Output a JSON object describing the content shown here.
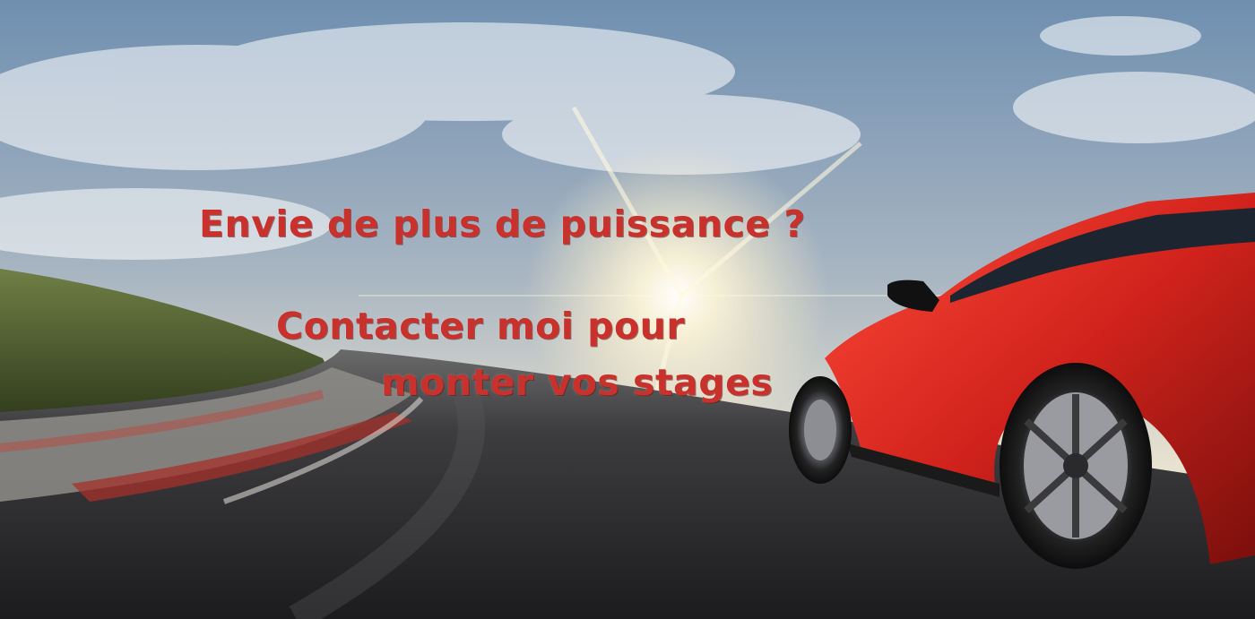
{
  "banner": {
    "line1": "Envie de plus de puissance ?",
    "line2": "Contacter moi pour",
    "line3": "monter vos stages"
  },
  "colors": {
    "text": "#c8312c",
    "car_body": "#d2231c",
    "sky_top": "#6f8fb0",
    "road": "#2b2c30"
  },
  "icons": [
    "sun-glare",
    "red-suv",
    "race-track"
  ]
}
